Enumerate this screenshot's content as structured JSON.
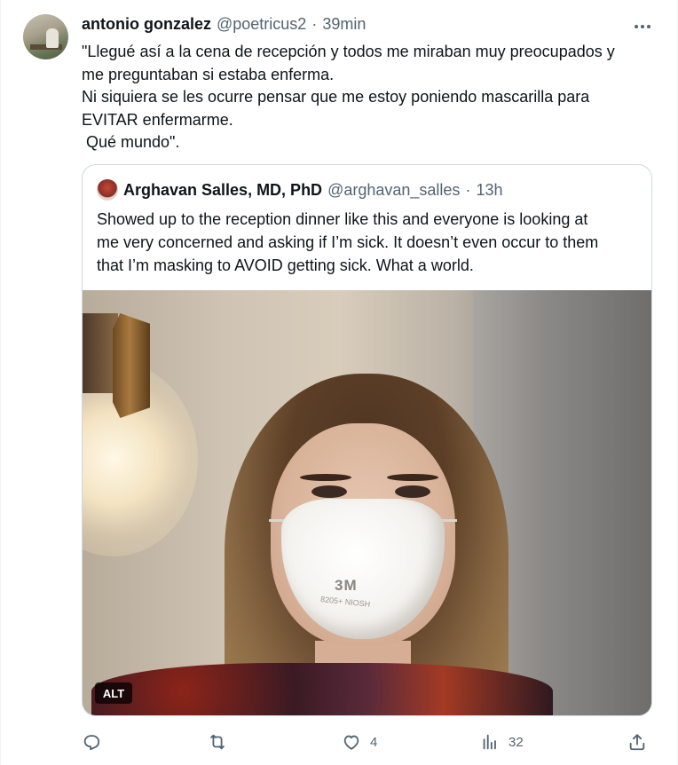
{
  "tweet": {
    "author_name": "antonio gonzalez",
    "author_handle": "@poetricus2",
    "separator": "·",
    "time": "39min",
    "text_lines": [
      "\"Llegué así a la cena de recepción y todos me miraban muy preocupados y",
      "me preguntaban si estaba enferma.",
      "Ni siquiera se les ocurre pensar que me estoy poniendo mascarilla para",
      "EVITAR enfermarme.",
      " Qué mundo\"."
    ]
  },
  "quoted_tweet": {
    "author_name": "Arghavan Salles, MD, PhD",
    "author_handle": "@arghavan_salles",
    "separator": "·",
    "time": "13h",
    "text_lines": [
      "Showed up to the reception dinner like this and everyone is looking at",
      "me very concerned and asking if I’m sick. It doesn’t even occur to them",
      "that I’m masking to AVOID getting sick. What a world."
    ],
    "media": {
      "alt_badge": "ALT",
      "mask_brand": "3M",
      "mask_print": "8205+ NIOSH"
    }
  },
  "actions": {
    "reply": {
      "icon": "reply-icon",
      "count": ""
    },
    "retweet": {
      "icon": "retweet-icon",
      "count": ""
    },
    "like": {
      "icon": "heart-icon",
      "count": "4"
    },
    "views": {
      "icon": "views-icon",
      "count": "32"
    },
    "share": {
      "icon": "share-icon",
      "count": ""
    }
  },
  "colors": {
    "text_primary": "#0f1419",
    "text_secondary": "#536471",
    "border": "#cfd9de"
  }
}
